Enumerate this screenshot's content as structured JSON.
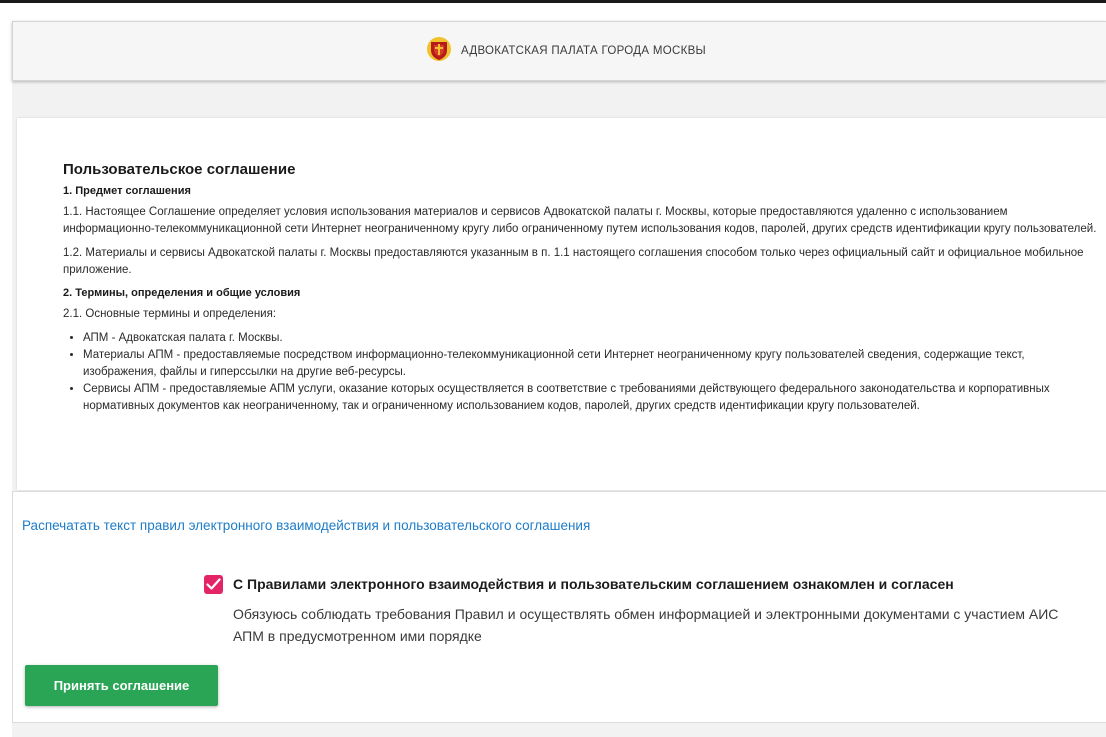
{
  "header": {
    "title": "АДВОКАТСКАЯ ПАЛАТА ГОРОДА МОСКВЫ",
    "logo_icon": "coat-of-arms-shield-icon"
  },
  "agreement": {
    "heading": "Пользовательское соглашение",
    "section1_title": "1. Предмет соглашения",
    "p1_1": "1.1. Настоящее Соглашение определяет условия использования материалов и сервисов Адвокатской палаты г. Москвы, которые предоставляются удаленно с использованием информационно-телекоммуникационной сети Интернет неограниченному кругу либо ограниченному путем использования кодов, паролей, других средств идентификации кругу пользователей.",
    "p1_2": "1.2. Материалы и сервисы Адвокатской палаты г. Москвы предоставляются указанным в п. 1.1 настоящего соглашения способом только через официальный сайт и официальное мобильное приложение.",
    "section2_title": "2. Термины, определения и общие условия",
    "p2_1": "2.1. Основные термины и определения:",
    "terms": [
      "АПМ - Адвокатская палата г. Москвы.",
      "Материалы АПМ - предоставляемые посредством информационно-телекоммуникационной сети Интернет неограниченному кругу пользователей сведения, содержащие текст, изображения, файлы и гиперссылки на другие веб-ресурсы.",
      "Сервисы АПМ - предоставляемые АПМ услуги, оказание которых осуществляется в соответствие с требованиями действующего федерального законодательства и корпоративных нормативных документов как неограниченному, так и ограниченному использованием кодов, паролей, других средств идентификации кругу пользователей."
    ]
  },
  "print_link": "Распечатать текст правил электронного взаимодействия и пользовательского соглашения",
  "consent": {
    "checked": true,
    "checkbox_color": "#e32467",
    "title": "С Правилами электронного взаимодействия и пользовательским соглашением ознакомлен и согласен",
    "description": "Обязуюсь соблюдать требования Правил и осуществлять обмен информацией и электронными документами с участием АИС АПМ в предусмотренном ими порядке"
  },
  "accept_button": {
    "label": "Принять соглашение",
    "color": "#2aa455"
  },
  "colors": {
    "link": "#1e7cc8",
    "background": "#f2f2f2"
  }
}
